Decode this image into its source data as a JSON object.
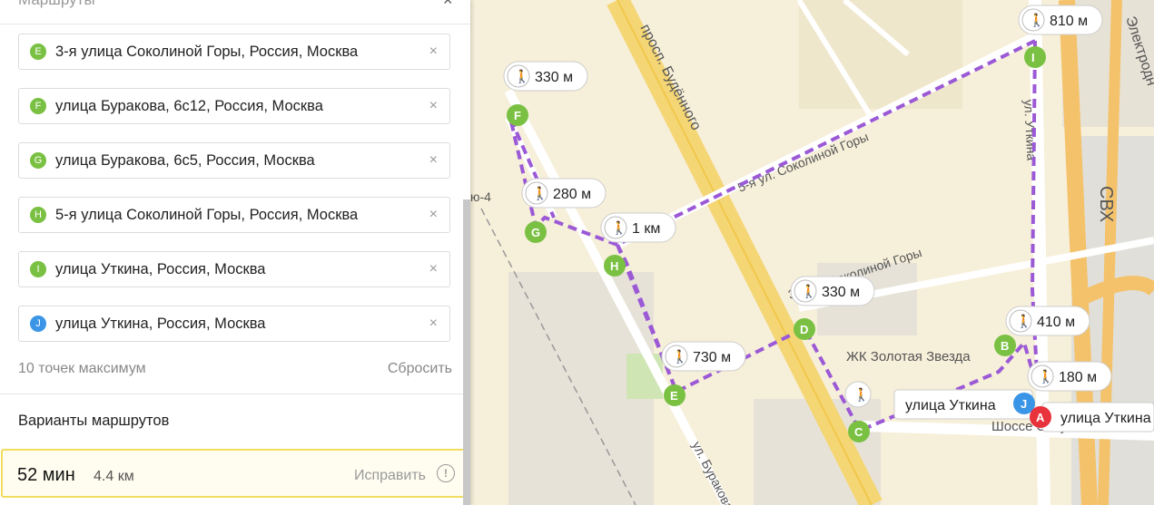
{
  "panel": {
    "title": "Маршруты",
    "waypoints": [
      {
        "letter": "E",
        "address": "3-я улица Соколиной Горы, Россия, Москва",
        "color": "#7ac143"
      },
      {
        "letter": "F",
        "address": "улица Буракова, 6с12, Россия, Москва",
        "color": "#7ac143"
      },
      {
        "letter": "G",
        "address": "улица Буракова, 6с5, Россия, Москва",
        "color": "#7ac143"
      },
      {
        "letter": "H",
        "address": "5-я улица Соколиной Горы, Россия, Москва",
        "color": "#7ac143"
      },
      {
        "letter": "I",
        "address": "улица Уткина, Россия, Москва",
        "color": "#7ac143"
      },
      {
        "letter": "J",
        "address": "улица Уткина, Россия, Москва",
        "color": "#3b95e6"
      }
    ],
    "clear_glyph": "×",
    "max_points": "10 точек максимум",
    "reset_label": "Сбросить",
    "variants_title": "Варианты маршрутов",
    "route": {
      "time": "52 мин",
      "distance": "4.4 км",
      "fix_label": "Исправить"
    }
  },
  "map": {
    "streets": {
      "budennogo": "просп. Будённого",
      "sokolinoy5": "5-я ул. Соколиной Горы",
      "utkina": "ул. Уткина",
      "svh": "СВХ",
      "burakova": "ул. Буракова",
      "elektrodnaya": "Электродн",
      "shosse": "Шоссе Энтузиастов",
      "sokolinoy3": "3-я ул. Соколиной Горы",
      "metro": "ю-4",
      "zhk": "ЖК Золотая Звезда"
    },
    "route_color": "#9b59d6",
    "marker_color": "#7ac143",
    "walk_bubbles": [
      {
        "id": "i",
        "label": "810 м"
      },
      {
        "id": "f",
        "label": "330 м"
      },
      {
        "id": "g",
        "label": "280 м"
      },
      {
        "id": "h",
        "label": "1 км"
      },
      {
        "id": "d",
        "label": "330 м"
      },
      {
        "id": "b",
        "label": "410 м"
      },
      {
        "id": "e",
        "label": "730 м"
      },
      {
        "id": "a",
        "label": "180 м"
      }
    ],
    "markers": [
      "I",
      "F",
      "G",
      "H",
      "D",
      "B",
      "E",
      "C"
    ],
    "endpoints": [
      {
        "letter": "J",
        "label": "улица Уткина",
        "color": "#3b95e6"
      },
      {
        "letter": "A",
        "label": "улица Уткина",
        "color": "#e8323c"
      }
    ]
  }
}
